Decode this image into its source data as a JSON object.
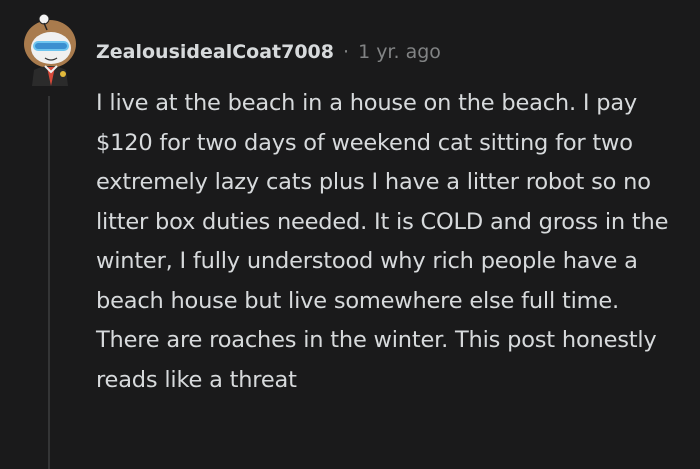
{
  "comment": {
    "username": "ZealousidealCoat7008",
    "separator": "·",
    "timestamp": "1 yr. ago",
    "avatar_icon": "snoo-avatar-icon",
    "body": "I live at the beach in a house on the beach. I pay $120 for two days of weekend cat sitting for two extremely lazy cats plus I have a litter robot so no litter box duties needed. It is COLD and gross in the winter, I fully understood why rich people have a beach house but live somewhere else full time. There are roaches in the winter. This post honestly reads like a threat"
  },
  "colors": {
    "background": "#1a1a1b",
    "text": "#d7dadc",
    "meta_text": "#818384",
    "thread_line": "#343536"
  }
}
